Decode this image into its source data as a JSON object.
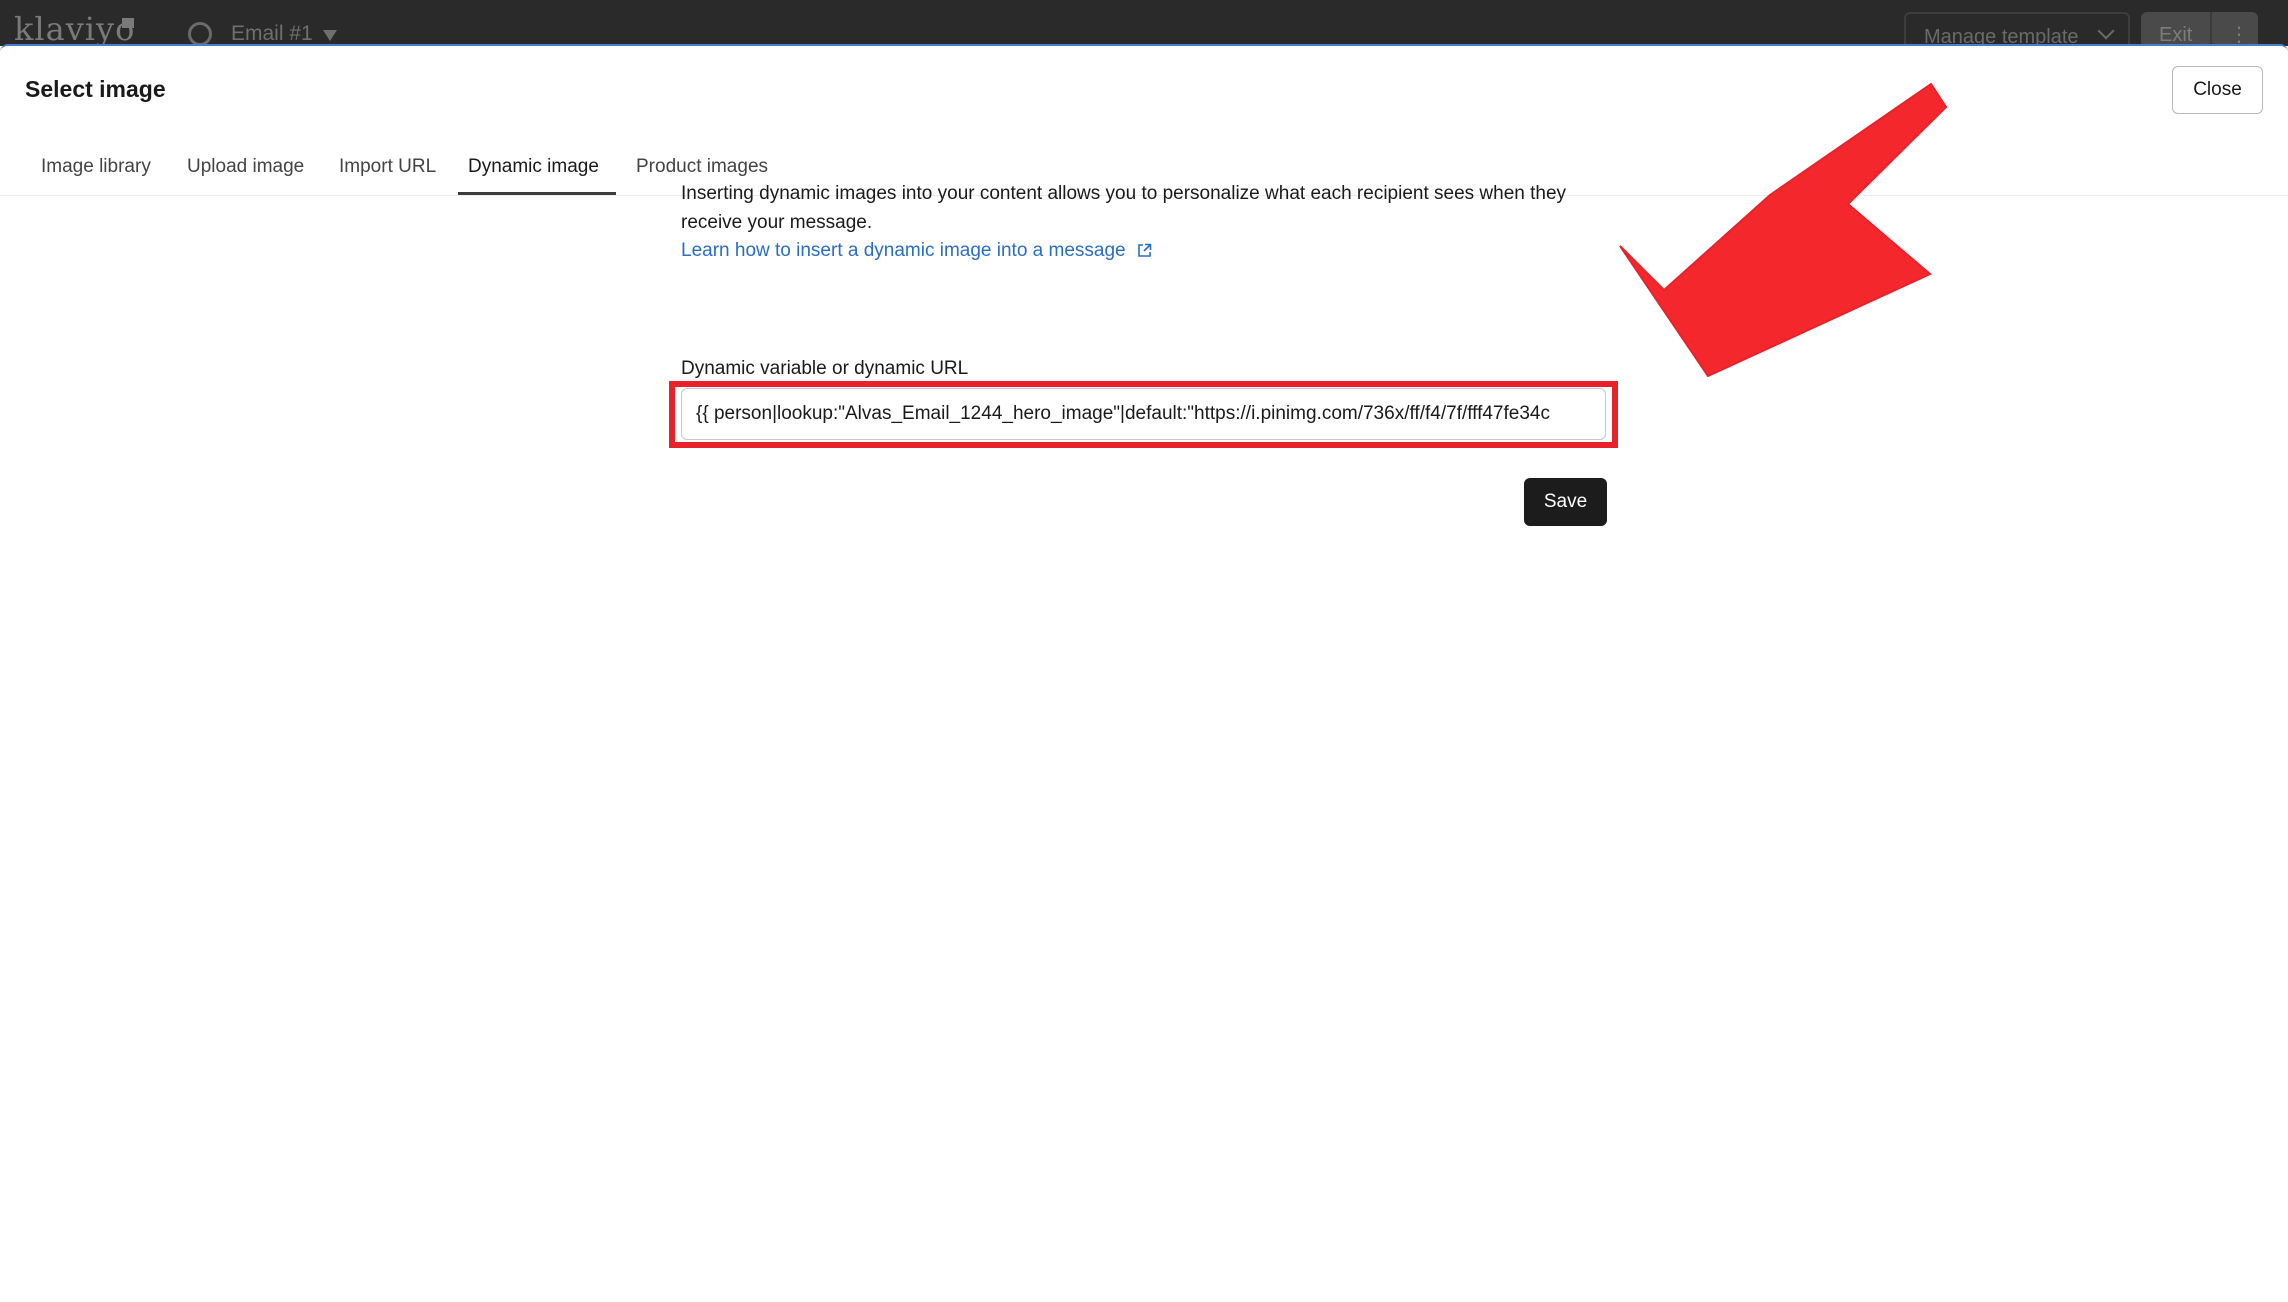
{
  "app_bar": {
    "logo": "klaviyo",
    "title": "Email #1",
    "manage_label": "Manage template",
    "exit_label": "Exit",
    "more_label": "⋮"
  },
  "modal": {
    "title": "Select image",
    "close_label": "Close",
    "tabs": [
      {
        "label": "Image library",
        "active": false
      },
      {
        "label": "Upload image",
        "active": false
      },
      {
        "label": "Import URL",
        "active": false
      },
      {
        "label": "Dynamic image",
        "active": true
      },
      {
        "label": "Product images",
        "active": false
      }
    ],
    "description": "Inserting dynamic images into your content allows you to personalize what each recipient sees when they receive your message.",
    "link_label": "Learn how to insert a dynamic image into a message",
    "field_label": "Dynamic variable or dynamic URL",
    "field_value": "{{ person|lookup:\"Alvas_Email_1244_hero_image\"|default:\"https://i.pinimg.com/736x/ff/f4/7f/fff47fe34c",
    "save_label": "Save"
  },
  "colors": {
    "accent_link": "#2a6ec4",
    "annotation_red": "#e8222a",
    "primary_button": "#1c1c1c"
  },
  "icons": {
    "link_icon": "external-link-icon",
    "annotation": "red-arrow-icon"
  }
}
